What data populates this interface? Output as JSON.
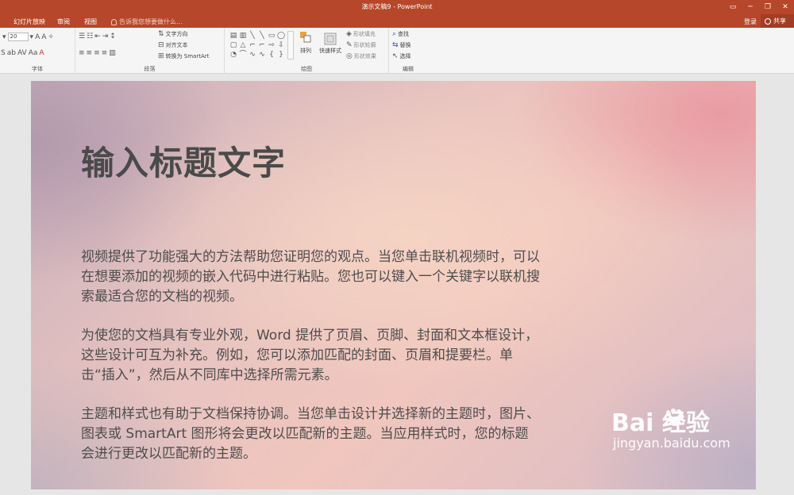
{
  "window": {
    "title": "演示文稿9 - PowerPoint",
    "controls": [
      "ribbon-display-icon",
      "minimize-icon",
      "restore-icon",
      "close-icon"
    ]
  },
  "tabs": {
    "items": [
      {
        "label": "幻灯片放映"
      },
      {
        "label": "审阅"
      },
      {
        "label": "视图"
      }
    ],
    "tell_me": "告诉我您想要做什么...",
    "login": "登录",
    "share": "共享"
  },
  "ribbon": {
    "font": {
      "size_value": "20",
      "group_label": "字体"
    },
    "paragraph": {
      "text_direction": "文字方向",
      "align_text": "对齐文本",
      "convert_smartart": "转换为 SmartArt",
      "group_label": "段落"
    },
    "drawing": {
      "arrange": "排列",
      "quick_styles": "快速样式",
      "shape_fill": "形状填充",
      "shape_outline": "形状轮廓",
      "shape_effects": "形状效果",
      "group_label": "绘图"
    },
    "editing": {
      "find": "查找",
      "replace": "替换",
      "select": "选择",
      "group_label": "编辑"
    }
  },
  "slide": {
    "title": "输入标题文字",
    "paragraphs": [
      "视频提供了功能强大的方法帮助您证明您的观点。当您单击联机视频时，可以在想要添加的视频的嵌入代码中进行粘贴。您也可以键入一个关键字以联机搜索最适合您的文档的视频。",
      "为使您的文档具有专业外观，Word 提供了页眉、页脚、封面和文本框设计，这些设计可互为补充。例如，您可以添加匹配的封面、页眉和提要栏。单击“插入”，然后从不同库中选择所需元素。",
      "主题和样式也有助于文档保持协调。当您单击设计并选择新的主题时，图片、图表或 SmartArt 图形将会更改以匹配新的主题。当应用样式时，您的标题会进行更改以匹配新的主题。"
    ]
  },
  "watermark": {
    "logo_text": "Bai  经验",
    "url": "jingyan.baidu.com"
  }
}
